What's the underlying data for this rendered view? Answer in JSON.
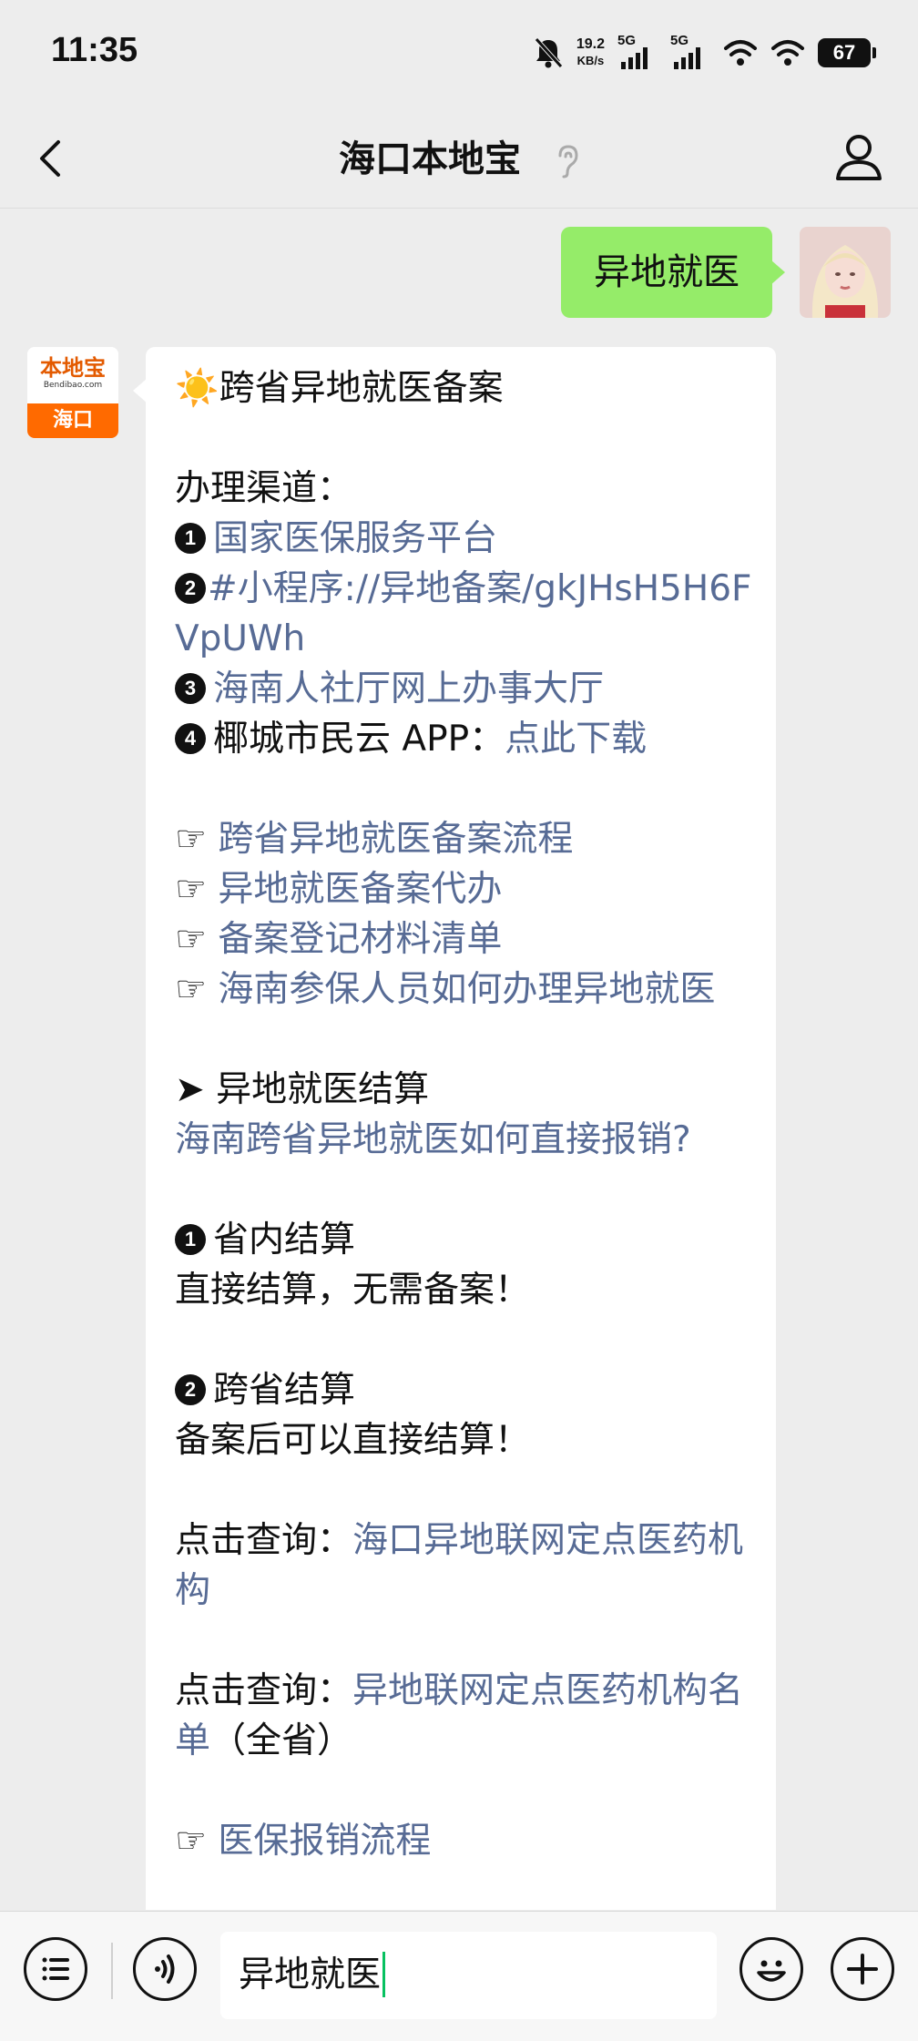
{
  "status_bar": {
    "time": "11:35",
    "net_speed_value": "19.2",
    "net_speed_unit": "KB/s",
    "signal1_label": "5G",
    "signal2_label": "5G",
    "battery": "67"
  },
  "nav": {
    "title": "海口本地宝",
    "back_icon": "chevron-left-icon",
    "ear_icon": "ear-icon",
    "profile_icon": "person-icon"
  },
  "chat": {
    "sent_message": "异地就医",
    "oa_avatar": {
      "logo_cn": "本地宝",
      "logo_en": "Bendibao.com",
      "city": "海口"
    },
    "reply": {
      "title_emoji": "☀️",
      "title": "跨省异地就医备案",
      "channels_heading": "办理渠道：",
      "channels": [
        {
          "marker": "1",
          "prefix": "",
          "link": "国家医保服务平台"
        },
        {
          "marker": "2",
          "prefix": "",
          "link": "#小程序://异地备案/gkJHsH5H6FVpUWh"
        },
        {
          "marker": "3",
          "prefix": "",
          "link": "海南人社厅网上办事大厅"
        },
        {
          "marker": "4",
          "prefix": "椰城市民云 APP：",
          "link": "点此下载"
        }
      ],
      "pointer_symbol": "☞",
      "pointer_links": [
        "跨省异地就医备案流程",
        "异地就医备案代办",
        "备案登记材料清单",
        "海南参保人员如何办理异地就医"
      ],
      "settle_heading": "➤ 异地就医结算",
      "settle_link": "海南跨省异地就医如何直接报销?",
      "in_province": {
        "marker": "1",
        "title": "省内结算",
        "desc": "直接结算，无需备案！"
      },
      "cross_province": {
        "marker": "2",
        "title": "跨省结算",
        "desc": "备案后可以直接结算！"
      },
      "query1_prefix": "点击查询：",
      "query1_link": "海口异地联网定点医药机构",
      "query2_prefix": "点击查询：",
      "query2_link": "异地联网定点医药机构名单",
      "query2_suffix": "（全省）",
      "last_link": "医保报销流程"
    }
  },
  "input_bar": {
    "menu_icon": "list-menu-icon",
    "voice_icon": "voice-icon",
    "text": "异地就医",
    "emoji_icon": "emoji-icon",
    "plus_icon": "plus-icon"
  },
  "colors": {
    "link": "#576b95",
    "sent_bubble": "#95ec69",
    "background": "#ededed",
    "caret": "#07c160",
    "logo_orange": "#ff6a00"
  }
}
